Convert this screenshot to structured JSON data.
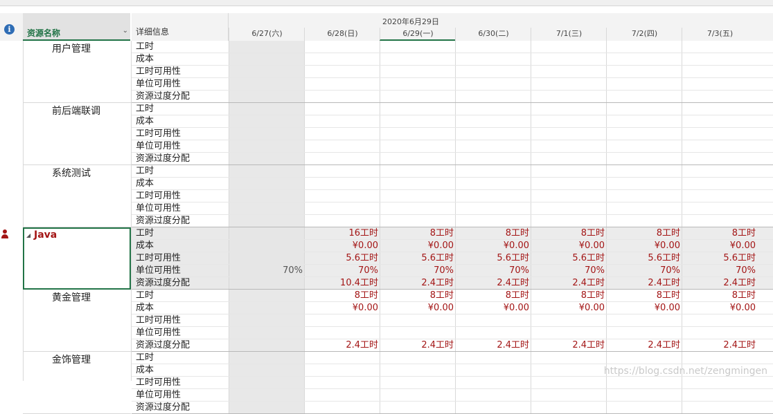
{
  "header": {
    "column_resource_name": "资源名称",
    "column_details": "详细信息",
    "timescale_major": "2020年6月29日",
    "days": [
      "6/27(六)",
      "6/28(日)",
      "6/29(一)",
      "6/30(二)",
      "7/1(三)",
      "7/2(四)",
      "7/3(五)"
    ],
    "current_day_index": 2,
    "info_icon": "i"
  },
  "detail_labels": [
    "工时",
    "成本",
    "工时可用性",
    "单位可用性",
    "资源过度分配"
  ],
  "resources": [
    {
      "name": "用户管理",
      "selected": false,
      "person_icon": false,
      "rows": [
        [
          "",
          "",
          "",
          "",
          "",
          "",
          ""
        ],
        [
          "",
          "",
          "",
          "",
          "",
          "",
          ""
        ],
        [
          "",
          "",
          "",
          "",
          "",
          "",
          ""
        ],
        [
          "",
          "",
          "",
          "",
          "",
          "",
          ""
        ],
        [
          "",
          "",
          "",
          "",
          "",
          "",
          ""
        ]
      ]
    },
    {
      "name": "前后端联调",
      "selected": false,
      "person_icon": false,
      "rows": [
        [
          "",
          "",
          "",
          "",
          "",
          "",
          ""
        ],
        [
          "",
          "",
          "",
          "",
          "",
          "",
          ""
        ],
        [
          "",
          "",
          "",
          "",
          "",
          "",
          ""
        ],
        [
          "",
          "",
          "",
          "",
          "",
          "",
          ""
        ],
        [
          "",
          "",
          "",
          "",
          "",
          "",
          ""
        ]
      ]
    },
    {
      "name": "系统测试",
      "selected": false,
      "person_icon": false,
      "rows": [
        [
          "",
          "",
          "",
          "",
          "",
          "",
          ""
        ],
        [
          "",
          "",
          "",
          "",
          "",
          "",
          ""
        ],
        [
          "",
          "",
          "",
          "",
          "",
          "",
          ""
        ],
        [
          "",
          "",
          "",
          "",
          "",
          "",
          ""
        ],
        [
          "",
          "",
          "",
          "",
          "",
          "",
          ""
        ]
      ]
    },
    {
      "name": "Java",
      "selected": true,
      "person_icon": true,
      "rows": [
        [
          "",
          "16工时",
          "8工时",
          "8工时",
          "8工时",
          "8工时",
          "8工时"
        ],
        [
          "",
          "¥0.00",
          "¥0.00",
          "¥0.00",
          "¥0.00",
          "¥0.00",
          "¥0.00"
        ],
        [
          "",
          "5.6工时",
          "5.6工时",
          "5.6工时",
          "5.6工时",
          "5.6工时",
          "5.6工时"
        ],
        [
          "70%",
          "70%",
          "70%",
          "70%",
          "70%",
          "70%",
          "70%"
        ],
        [
          "",
          "10.4工时",
          "2.4工时",
          "2.4工时",
          "2.4工时",
          "2.4工时",
          "2.4工时"
        ]
      ]
    },
    {
      "name": "黄金管理",
      "selected": false,
      "person_icon": false,
      "rows": [
        [
          "",
          "8工时",
          "8工时",
          "8工时",
          "8工时",
          "8工时",
          "8工时"
        ],
        [
          "",
          "¥0.00",
          "¥0.00",
          "¥0.00",
          "¥0.00",
          "¥0.00",
          "¥0.00"
        ],
        [
          "",
          "",
          "",
          "",
          "",
          "",
          ""
        ],
        [
          "",
          "",
          "",
          "",
          "",
          "",
          ""
        ],
        [
          "",
          "2.4工时",
          "2.4工时",
          "2.4工时",
          "2.4工时",
          "2.4工时",
          "2.4工时"
        ]
      ]
    },
    {
      "name": "金饰管理",
      "selected": false,
      "person_icon": false,
      "rows": [
        [
          "",
          "",
          "",
          "",
          "",
          "",
          ""
        ],
        [
          "",
          "",
          "",
          "",
          "",
          "",
          ""
        ],
        [
          "",
          "",
          "",
          "",
          "",
          "",
          ""
        ],
        [
          "",
          "",
          "",
          "",
          "",
          "",
          ""
        ],
        [
          "",
          "",
          "",
          "",
          "",
          "",
          ""
        ]
      ]
    }
  ],
  "watermark": "https://blog.csdn.net/zengmingen",
  "colors": {
    "accent": "#217346",
    "value_red": "#a31515",
    "info_blue": "#2f6db5"
  }
}
